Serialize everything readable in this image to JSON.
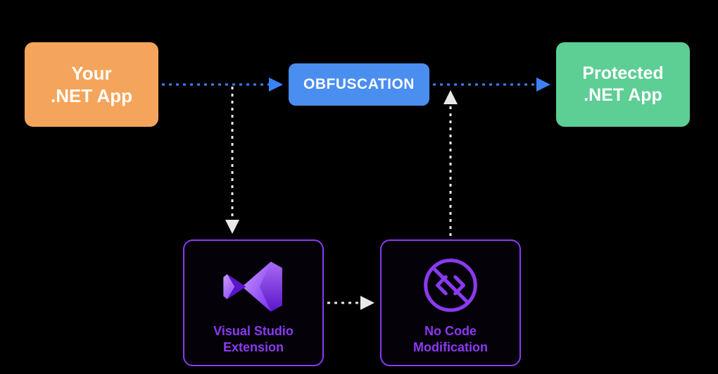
{
  "diagram": {
    "nodes": {
      "source": {
        "label": "Your\n.NET App"
      },
      "process": {
        "label": "OBFUSCATION"
      },
      "output": {
        "label": "Protected\n.NET App"
      },
      "vs": {
        "label": "Visual Studio\nExtension"
      },
      "ncm": {
        "label": "No Code\nModification"
      }
    },
    "colors": {
      "source": "#f5a55b",
      "process": "#4a8ef0",
      "output": "#5dce94",
      "secondary_border": "#8a3af2",
      "accent_arrow": "#3b82f6"
    },
    "flow": [
      {
        "from": "source",
        "to": "process",
        "style": "blue-dashed"
      },
      {
        "from": "process",
        "to": "output",
        "style": "blue-dashed"
      },
      {
        "from": "source-path",
        "to": "vs",
        "style": "white-dashed"
      },
      {
        "from": "vs",
        "to": "ncm",
        "style": "white-dashed"
      },
      {
        "from": "ncm",
        "to": "output-path",
        "style": "white-dashed"
      }
    ]
  }
}
